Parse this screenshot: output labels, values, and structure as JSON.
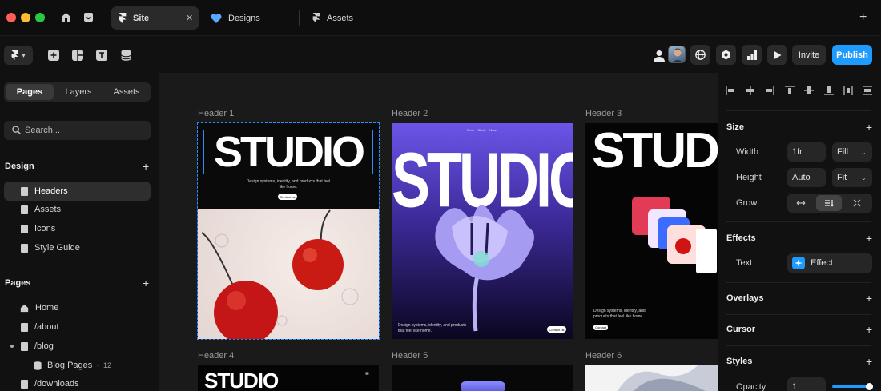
{
  "tabs": {
    "site": "Site",
    "designs": "Designs",
    "assets": "Assets"
  },
  "toolbar": {
    "invite": "Invite",
    "publish": "Publish"
  },
  "left": {
    "segments": [
      "Pages",
      "Layers",
      "Assets"
    ],
    "search_placeholder": "Search...",
    "design_heading": "Design",
    "design_items": [
      "Headers",
      "Assets",
      "Icons",
      "Style Guide"
    ],
    "pages_heading": "Pages",
    "page_items": [
      "Home",
      "/about",
      "/blog",
      "Blog Pages",
      "/downloads"
    ],
    "blog_pages_count": "12"
  },
  "canvas": {
    "frames": [
      {
        "label": "Header 1",
        "title": "STUDIO",
        "tagline": "Design systems, identity, and products that feel like home.",
        "cta": "Contact us"
      },
      {
        "label": "Header 2",
        "title": "STUDIO",
        "nav": [
          "Work",
          "Study",
          "News"
        ],
        "tagline": "Design systems, identity, and products that feel like home.",
        "cta": "Contact us"
      },
      {
        "label": "Header 3",
        "title": "STUDIO",
        "tagline": "Design systems, identity, and products that feel like home.",
        "cta": "Contact"
      },
      {
        "label": "Header 4",
        "title": "STUDIO"
      },
      {
        "label": "Header 5"
      },
      {
        "label": "Header 6"
      }
    ]
  },
  "right": {
    "size": {
      "heading": "Size",
      "width_label": "Width",
      "width_value": "1fr",
      "width_mode": "Fill",
      "height_label": "Height",
      "height_value": "Auto",
      "height_mode": "Fit",
      "grow_label": "Grow"
    },
    "effects": {
      "heading": "Effects",
      "text_label": "Text",
      "effect_value": "Effect"
    },
    "overlays_heading": "Overlays",
    "cursor_heading": "Cursor",
    "styles": {
      "heading": "Styles",
      "opacity_label": "Opacity",
      "opacity_value": "1"
    }
  },
  "colors": {
    "accent": "#1e9bff",
    "selection": "#2a8cff",
    "red_light": "#ff5f57",
    "yellow_light": "#febc2e",
    "green_light": "#28c840"
  }
}
